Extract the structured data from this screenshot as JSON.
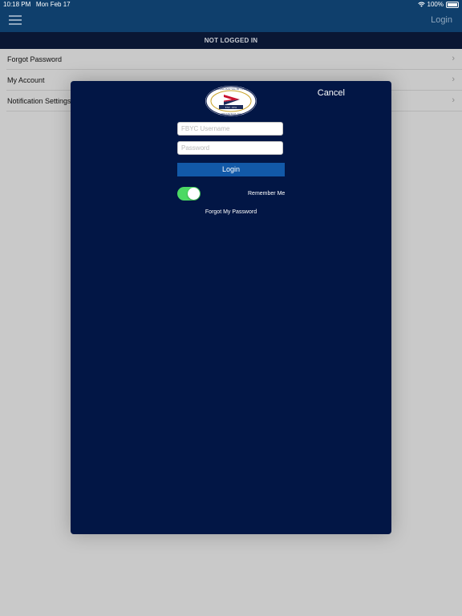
{
  "status_bar": {
    "time": "10:18 PM",
    "date": "Mon Feb 17",
    "battery": "100%"
  },
  "nav": {
    "login_label": "Login",
    "menu_icon": "hamburger-icon"
  },
  "banner": {
    "text": "NOT LOGGED IN"
  },
  "list": {
    "items": [
      {
        "label": "Forgot Password"
      },
      {
        "label": "My Account"
      },
      {
        "label": "Notification Settings"
      }
    ]
  },
  "modal": {
    "cancel_label": "Cancel",
    "logo": {
      "top_text": "FISHING BAY YACHT CLUB",
      "est": "EST. 1931",
      "bottom_text": "DELTAVILLE, VA"
    },
    "username": {
      "placeholder": "FBYC Username",
      "value": ""
    },
    "password": {
      "placeholder": "Password",
      "value": ""
    },
    "login_button": "Login",
    "remember_label": "Remember Me",
    "remember_on": true,
    "forgot_link": "Forgot My Password"
  },
  "colors": {
    "nav": "#0f3f6c",
    "banner": "#0a1734",
    "modal": "#021645",
    "button": "#1259a8",
    "toggle_on": "#4cd964"
  }
}
